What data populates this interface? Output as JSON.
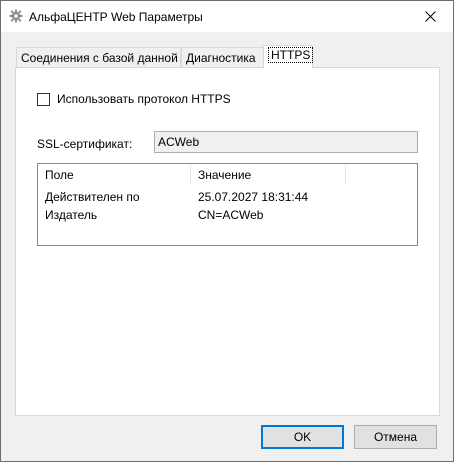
{
  "window": {
    "title": "АльфаЦЕНТР Web Параметры",
    "app_icon": "gear-icon",
    "close_icon": "close-icon"
  },
  "tabs": [
    {
      "label": "Соединения с базой данной",
      "active": false
    },
    {
      "label": "Диагностика",
      "active": false
    },
    {
      "label": "HTTPS",
      "active": true
    }
  ],
  "https": {
    "use_https_label": "Использовать протокол HTTPS",
    "use_https_checked": false,
    "certificate_label": "SSL-сертификат:",
    "certificate_value": "ACWeb",
    "table": {
      "columns": [
        "Поле",
        "Значение"
      ],
      "rows": [
        [
          "Действителен по",
          "25.07.2027 18:31:44"
        ],
        [
          "Издатель",
          "CN=ACWeb"
        ]
      ]
    }
  },
  "buttons": {
    "ok_label": "OK",
    "cancel_label": "Отмена"
  },
  "colors": {
    "default_button_border": "#0078d7",
    "panel_bg": "#ffffff",
    "dialog_bg": "#f0f0f0"
  }
}
